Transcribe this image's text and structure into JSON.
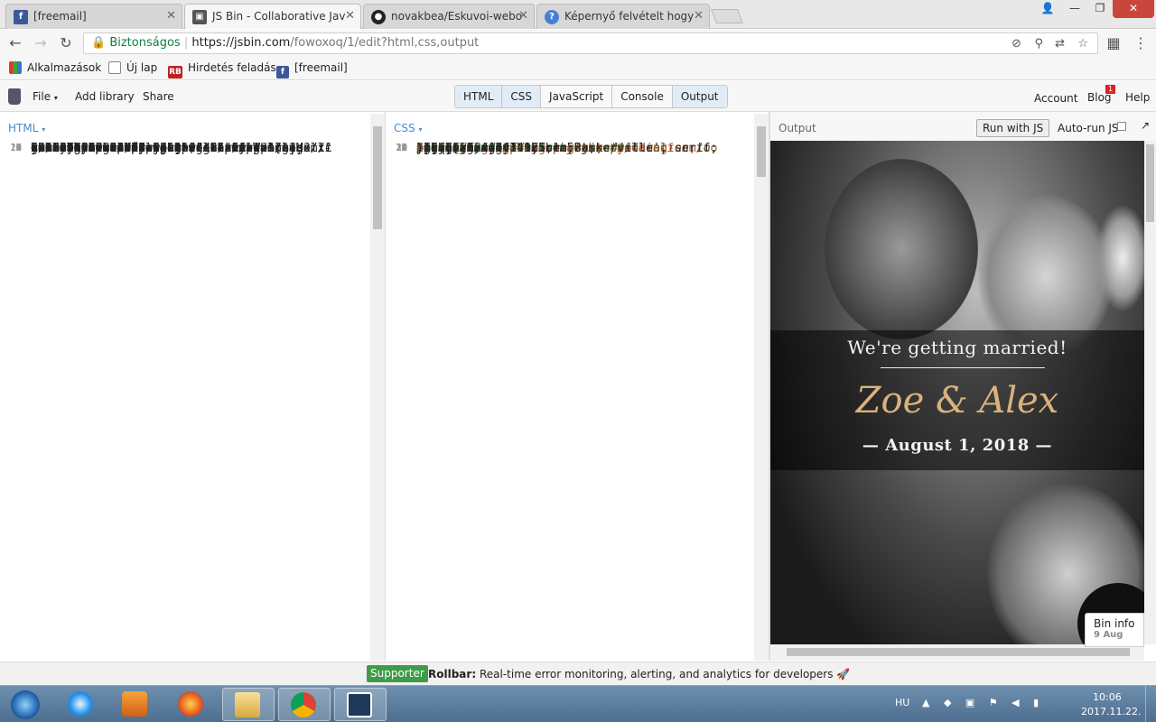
{
  "browser": {
    "tabs": [
      {
        "title": "[freemail]",
        "icon": "freemail-icon",
        "active": false
      },
      {
        "title": "JS Bin - Collaborative Jav",
        "icon": "jsbin-icon",
        "active": true
      },
      {
        "title": "novakbea/Eskuvoi-webo",
        "icon": "github-icon",
        "active": false
      },
      {
        "title": "Képernyő felvételt hogy",
        "icon": "help-icon",
        "active": false
      }
    ],
    "secure_label": "Biztonságos",
    "url_host": "https://jsbin.com",
    "url_path": "/fowoxoq/1/edit?html,css,output",
    "bookmarks": [
      {
        "label": "Alkalmazások",
        "icon": "apps-icon"
      },
      {
        "label": "Új lap",
        "icon": "page-icon"
      },
      {
        "label": "Hirdetés feladás",
        "icon": "rb-icon",
        "badge": "RB"
      },
      {
        "label": "[freemail]",
        "icon": "freemail-icon",
        "badge": "f"
      }
    ]
  },
  "jsbin": {
    "menu": {
      "file": "File",
      "add_library": "Add library",
      "share": "Share"
    },
    "panels": [
      "HTML",
      "CSS",
      "JavaScript",
      "Console",
      "Output"
    ],
    "right": {
      "account": "Account",
      "blog": "Blog",
      "blog_badge": "1",
      "help": "Help"
    },
    "html_panel_title": "HTML",
    "css_panel_title": "CSS",
    "output_title": "Output",
    "run_button": "Run with JS",
    "autorun_label": "Auto-run JS",
    "bin_info": {
      "label": "Bin info",
      "date": "9 Aug"
    }
  },
  "html_lines": [
    {
      "n": "1",
      "text": "<!DOCTYPE html>"
    },
    {
      "n": "2",
      "text": "<html>"
    },
    {
      "n": "3",
      "text": "<head>"
    },
    {
      "n": "4",
      "text": "<meta name=\"description\" content=\"[add"
    },
    {
      "n": "",
      "text": "your bin description]\">"
    },
    {
      "n": "5",
      "text": " <meta charset=\"utf-8\">"
    },
    {
      "n": "6",
      "text": "  <meta name=\"viewport\""
    },
    {
      "n": "",
      "text": "content=\"width=device-width initial-"
    },
    {
      "n": "",
      "text": "scale=1\">"
    },
    {
      "n": "7",
      "text": "  <link"
    },
    {
      "n": "",
      "text": "href=\"https://fonts.googleapis.com/css?"
    },
    {
      "n": "",
      "text": "family=Great+Vibes|Libre+Baskerville|Muli\""
    },
    {
      "n": "",
      "text": "rel=\"stylesheet\">"
    },
    {
      "n": "8",
      "text": "  <link rel=\"stylesheet\""
    },
    {
      "n": "",
      "text": "href=\"https://cdnjs.cloudflare.com/ajax/li"
    },
    {
      "n": "",
      "text": "bs/meyer-reset/2.0/reset.css\">"
    },
    {
      "n": "9",
      "text": "  <link rel=\"shortcut icon\" type=\"image/x-"
    },
    {
      "n": "",
      "text": "icon\""
    },
    {
      "n": "",
      "text": "href=\"https://orange.codeberryschool.com/c"
    },
    {
      "n": "",
      "text": "ontent/images/project-assets/wedding-"
    },
    {
      "n": "",
      "text": "landing-favicon.png\">"
    },
    {
      "n": "10",
      "text": "  <title>Esküvői weboldal</title>"
    },
    {
      "n": "11",
      "text": "</head>"
    },
    {
      "n": "12",
      "text": "<body>"
    },
    {
      "n": "13",
      "text": "<header class=\"cover\">"
    },
    {
      "n": "14",
      "text": "      <div class=\"hero-text-wrapper\">"
    },
    {
      "n": "15",
      "text": "        <div class=\"hero-text\">"
    },
    {
      "n": "16",
      "text": "          <div class=\"tagline\">We're"
    },
    {
      "n": "",
      "text": "getting married!</div>"
    },
    {
      "n": "17",
      "text": "          <h1>Zoe &amp; Alex</h1>"
    },
    {
      "n": "18",
      "text": "          <span class=\"date\">August 1,"
    },
    {
      "n": "",
      "text": "2018</span>"
    },
    {
      "n": "19",
      "text": "        </div>"
    },
    {
      "n": "20",
      "text": "      </div>"
    }
  ],
  "css_lines": [
    {
      "n": "1",
      "text": "/* ============================",
      "c": "cm"
    },
    {
      "n": "2",
      "text": "",
      "c": ""
    },
    {
      "n": "3",
      "text": "    GENERAL STYLES",
      "c": "cm"
    },
    {
      "n": "4",
      "text": "",
      "c": ""
    },
    {
      "n": "5",
      "text": "============================*/",
      "c": "cm"
    },
    {
      "n": "6",
      "text": "",
      "c": ""
    },
    {
      "n": "7",
      "text": "* {",
      "c": ""
    },
    {
      "n": "8",
      "text": "  box-sizing: border-box;",
      "c": ""
    },
    {
      "n": "9",
      "text": "}",
      "c": ""
    },
    {
      "n": "10",
      "text": "",
      "c": ""
    },
    {
      "n": "11",
      "text": "/* Single-direction margin declaration to",
      "c": "cm"
    },
    {
      "n": "",
      "text": "establish vertical rhythm. */",
      "c": "cm"
    },
    {
      "n": "12",
      "text": "h1,h2,h3,",
      "c": ""
    },
    {
      "n": "13",
      "text": "ul,ol,",
      "c": ""
    },
    {
      "n": "14",
      "text": "p,",
      "c": ""
    },
    {
      "n": "15",
      "text": "img {",
      "c": ""
    },
    {
      "n": "16",
      "text": "    margin-bottom: 1.5rem;",
      "c": ""
    },
    {
      "n": "17",
      "text": "}",
      "c": ""
    },
    {
      "n": "18",
      "text": "",
      "c": ""
    },
    {
      "n": "19",
      "text": "body {",
      "c": ""
    },
    {
      "n": "20",
      "text": "  background:",
      "c": ""
    },
    {
      "n": "",
      "text": "url('https://orange.codeberryschool.com/co",
      "c": "str"
    },
    {
      "n": "",
      "text": "ntent/images/project-assets/wedding-",
      "c": "str"
    },
    {
      "n": "",
      "text": "landing-background.png') repeat center;",
      "c": "str"
    },
    {
      "n": "21",
      "text": "  font-family: 'Libre Baskerville', serif;",
      "c": ""
    },
    {
      "n": "22",
      "text": "  font-size: 1.125rem;",
      "c": ""
    },
    {
      "n": "23",
      "text": "  line-height: 1.5;",
      "c": ""
    },
    {
      "n": "24",
      "text": "  color: #444349;",
      "c": ""
    },
    {
      "n": "25",
      "text": "}",
      "c": ""
    },
    {
      "n": "26",
      "text": "",
      "c": ""
    },
    {
      "n": "27",
      "text": ".locations,",
      "c": ""
    },
    {
      "n": "28",
      "text": ".program,",
      "c": ""
    },
    {
      "n": "29",
      "text": ".gifts,",
      "c": ""
    },
    {
      "n": "30",
      "text": ".faq,",
      "c": ""
    }
  ],
  "output": {
    "tagline": "We're getting married!",
    "names": "Zoe & Alex",
    "date": "— August 1, 2018 —"
  },
  "rollbar": {
    "supporter": "Supporter",
    "brand": "Rollbar:",
    "text": "Real-time error monitoring, alerting, and analytics for developers"
  },
  "taskbar": {
    "lang": "HU",
    "time": "10:06",
    "date": "2017.11.22."
  },
  "colors": {
    "accent": "#4a89c8",
    "secure": "#0b8043",
    "gold": "#d9b27c",
    "supporter": "#3e9c48"
  }
}
